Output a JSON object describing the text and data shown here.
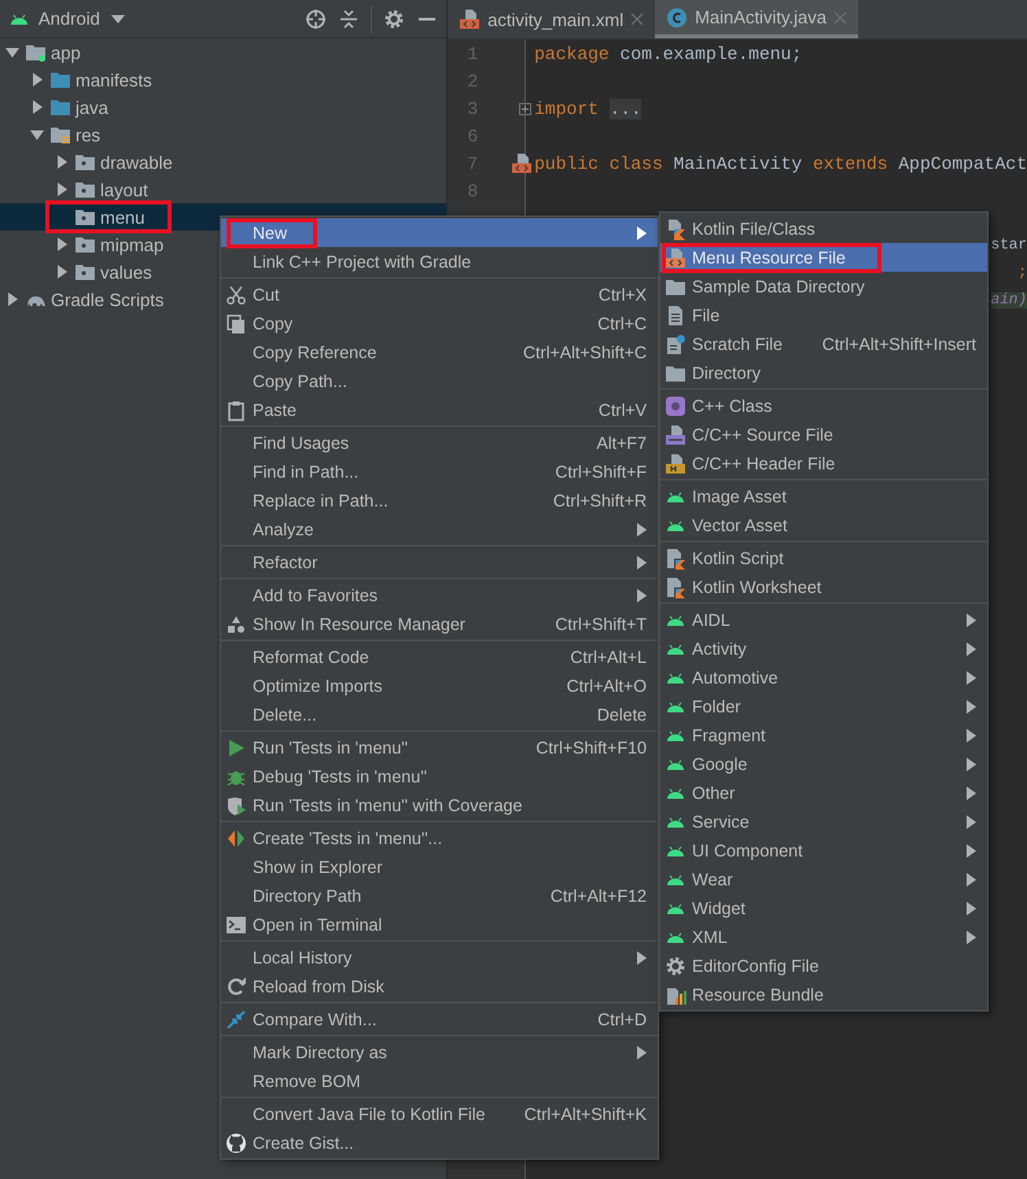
{
  "project_view": {
    "title": "Android",
    "tree": [
      {
        "label": "app",
        "expandable": true,
        "expanded": true,
        "selected": false,
        "highlighted": false,
        "children": [
          {
            "label": "manifests",
            "expandable": true,
            "expanded": false,
            "selected": false,
            "highlighted": false
          },
          {
            "label": "java",
            "expandable": true,
            "expanded": false,
            "selected": false,
            "highlighted": false
          },
          {
            "label": "res",
            "expandable": true,
            "expanded": true,
            "selected": false,
            "highlighted": false,
            "children": [
              {
                "label": "drawable",
                "expandable": true,
                "expanded": false,
                "selected": false,
                "highlighted": false
              },
              {
                "label": "layout",
                "expandable": true,
                "expanded": false,
                "selected": false,
                "highlighted": false
              },
              {
                "label": "menu",
                "expandable": false,
                "selected": true,
                "highlighted": true
              },
              {
                "label": "mipmap",
                "expandable": true,
                "expanded": false,
                "selected": false,
                "highlighted": false
              },
              {
                "label": "values",
                "expandable": true,
                "expanded": false,
                "selected": false,
                "highlighted": false
              }
            ]
          }
        ]
      },
      {
        "label": "Gradle Scripts",
        "expandable": true,
        "expanded": false,
        "selected": false,
        "highlighted": false
      }
    ]
  },
  "editor": {
    "tabs": [
      {
        "label": "activity_main.xml",
        "selected": false
      },
      {
        "label": "MainActivity.java",
        "selected": true
      }
    ],
    "lines": [
      {
        "number": "1",
        "fold": false,
        "marker": false,
        "tokens": [
          {
            "kind": "keyword",
            "text": "package"
          },
          {
            "kind": "plain",
            "text": " com.example.menu;"
          }
        ]
      },
      {
        "number": "2",
        "fold": false,
        "marker": false
      },
      {
        "number": "3",
        "fold": true,
        "marker": false,
        "tokens": [
          {
            "kind": "keyword",
            "text": "import"
          },
          {
            "kind": "folded",
            "text": "..."
          }
        ]
      },
      {
        "number": "6",
        "fold": false,
        "marker": false
      },
      {
        "number": "7",
        "fold": false,
        "marker": true,
        "tokens": [
          {
            "kind": "keyword",
            "text": "public class"
          },
          {
            "kind": "plain",
            "text": " MainActivity "
          },
          {
            "kind": "keyword",
            "text": "extends"
          },
          {
            "kind": "plain",
            "text": " AppCompatAct"
          }
        ]
      },
      {
        "number": "8",
        "fold": false,
        "marker": false
      }
    ],
    "fragments": [
      {
        "kind": "plain",
        "text": "star"
      },
      {
        "kind": "keyword",
        "text": ";"
      },
      {
        "kind": "italic",
        "text": "ain)"
      }
    ]
  },
  "context_menu": {
    "sections": [
      [
        {
          "label": "New",
          "submenu": true,
          "selected": true,
          "highlighted": true
        },
        {
          "label": "Link C++ Project with Gradle",
          "submenu": false,
          "selected": false,
          "highlighted": false
        }
      ],
      [
        {
          "label": "Cut",
          "shortcut": "Ctrl+X",
          "submenu": false,
          "selected": false,
          "highlighted": false
        },
        {
          "label": "Copy",
          "shortcut": "Ctrl+C",
          "submenu": false,
          "selected": false,
          "highlighted": false
        },
        {
          "label": "Copy Reference",
          "shortcut": "Ctrl+Alt+Shift+C",
          "submenu": false,
          "selected": false,
          "highlighted": false
        },
        {
          "label": "Copy Path...",
          "submenu": false,
          "selected": false,
          "highlighted": false
        },
        {
          "label": "Paste",
          "shortcut": "Ctrl+V",
          "submenu": false,
          "selected": false,
          "highlighted": false
        }
      ],
      [
        {
          "label": "Find Usages",
          "shortcut": "Alt+F7",
          "submenu": false,
          "selected": false,
          "highlighted": false
        },
        {
          "label": "Find in Path...",
          "shortcut": "Ctrl+Shift+F",
          "submenu": false,
          "selected": false,
          "highlighted": false
        },
        {
          "label": "Replace in Path...",
          "shortcut": "Ctrl+Shift+R",
          "submenu": false,
          "selected": false,
          "highlighted": false
        },
        {
          "label": "Analyze",
          "submenu": true,
          "selected": false,
          "highlighted": false
        }
      ],
      [
        {
          "label": "Refactor",
          "submenu": true,
          "selected": false,
          "highlighted": false
        }
      ],
      [
        {
          "label": "Add to Favorites",
          "submenu": true,
          "selected": false,
          "highlighted": false
        },
        {
          "label": "Show In Resource Manager",
          "shortcut": "Ctrl+Shift+T",
          "submenu": false,
          "selected": false,
          "highlighted": false
        }
      ],
      [
        {
          "label": "Reformat Code",
          "shortcut": "Ctrl+Alt+L",
          "submenu": false,
          "selected": false,
          "highlighted": false
        },
        {
          "label": "Optimize Imports",
          "shortcut": "Ctrl+Alt+O",
          "submenu": false,
          "selected": false,
          "highlighted": false
        },
        {
          "label": "Delete...",
          "shortcut": "Delete",
          "submenu": false,
          "selected": false,
          "highlighted": false
        }
      ],
      [
        {
          "label": "Run 'Tests in 'menu''",
          "shortcut": "Ctrl+Shift+F10",
          "submenu": false,
          "selected": false,
          "highlighted": false
        },
        {
          "label": "Debug 'Tests in 'menu''",
          "submenu": false,
          "selected": false,
          "highlighted": false
        },
        {
          "label": "Run 'Tests in 'menu'' with Coverage",
          "submenu": false,
          "selected": false,
          "highlighted": false
        }
      ],
      [
        {
          "label": "Create 'Tests in 'menu''...",
          "submenu": false,
          "selected": false,
          "highlighted": false
        },
        {
          "label": "Show in Explorer",
          "submenu": false,
          "selected": false,
          "highlighted": false
        },
        {
          "label": "Directory Path",
          "shortcut": "Ctrl+Alt+F12",
          "submenu": false,
          "selected": false,
          "highlighted": false
        },
        {
          "label": "Open in Terminal",
          "submenu": false,
          "selected": false,
          "highlighted": false
        }
      ],
      [
        {
          "label": "Local History",
          "submenu": true,
          "selected": false,
          "highlighted": false
        },
        {
          "label": "Reload from Disk",
          "submenu": false,
          "selected": false,
          "highlighted": false
        }
      ],
      [
        {
          "label": "Compare With...",
          "shortcut": "Ctrl+D",
          "submenu": false,
          "selected": false,
          "highlighted": false
        }
      ],
      [
        {
          "label": "Mark Directory as",
          "submenu": true,
          "selected": false,
          "highlighted": false
        },
        {
          "label": "Remove BOM",
          "submenu": false,
          "selected": false,
          "highlighted": false
        }
      ],
      [
        {
          "label": "Convert Java File to Kotlin File",
          "shortcut": "Ctrl+Alt+Shift+K",
          "submenu": false,
          "selected": false,
          "highlighted": false
        },
        {
          "label": "Create Gist...",
          "submenu": false,
          "selected": false,
          "highlighted": false
        }
      ]
    ]
  },
  "new_submenu": {
    "sections": [
      [
        {
          "label": "Kotlin File/Class",
          "submenu": false,
          "selected": false,
          "highlighted": false
        },
        {
          "label": "Menu Resource File",
          "submenu": false,
          "selected": true,
          "highlighted": true
        },
        {
          "label": "Sample Data Directory",
          "submenu": false,
          "selected": false,
          "highlighted": false
        },
        {
          "label": "File",
          "submenu": false,
          "selected": false,
          "highlighted": false
        },
        {
          "label": "Scratch File",
          "shortcut": "Ctrl+Alt+Shift+Insert",
          "submenu": false,
          "selected": false,
          "highlighted": false
        },
        {
          "label": "Directory",
          "submenu": false,
          "selected": false,
          "highlighted": false
        }
      ],
      [
        {
          "label": "C++ Class",
          "submenu": false,
          "selected": false,
          "highlighted": false
        },
        {
          "label": "C/C++ Source File",
          "submenu": false,
          "selected": false,
          "highlighted": false
        },
        {
          "label": "C/C++ Header File",
          "submenu": false,
          "selected": false,
          "highlighted": false
        }
      ],
      [
        {
          "label": "Image Asset",
          "submenu": false,
          "selected": false,
          "highlighted": false
        },
        {
          "label": "Vector Asset",
          "submenu": false,
          "selected": false,
          "highlighted": false
        }
      ],
      [
        {
          "label": "Kotlin Script",
          "submenu": false,
          "selected": false,
          "highlighted": false
        },
        {
          "label": "Kotlin Worksheet",
          "submenu": false,
          "selected": false,
          "highlighted": false
        }
      ],
      [
        {
          "label": "AIDL",
          "submenu": true,
          "selected": false,
          "highlighted": false
        },
        {
          "label": "Activity",
          "submenu": true,
          "selected": false,
          "highlighted": false
        },
        {
          "label": "Automotive",
          "submenu": true,
          "selected": false,
          "highlighted": false
        },
        {
          "label": "Folder",
          "submenu": true,
          "selected": false,
          "highlighted": false
        },
        {
          "label": "Fragment",
          "submenu": true,
          "selected": false,
          "highlighted": false
        },
        {
          "label": "Google",
          "submenu": true,
          "selected": false,
          "highlighted": false
        },
        {
          "label": "Other",
          "submenu": true,
          "selected": false,
          "highlighted": false
        },
        {
          "label": "Service",
          "submenu": true,
          "selected": false,
          "highlighted": false
        },
        {
          "label": "UI Component",
          "submenu": true,
          "selected": false,
          "highlighted": false
        },
        {
          "label": "Wear",
          "submenu": true,
          "selected": false,
          "highlighted": false
        },
        {
          "label": "Widget",
          "submenu": true,
          "selected": false,
          "highlighted": false
        },
        {
          "label": "XML",
          "submenu": true,
          "selected": false,
          "highlighted": false
        },
        {
          "label": "EditorConfig File",
          "submenu": false,
          "selected": false,
          "highlighted": false
        },
        {
          "label": "Resource Bundle",
          "submenu": false,
          "selected": false,
          "highlighted": false
        }
      ]
    ]
  }
}
